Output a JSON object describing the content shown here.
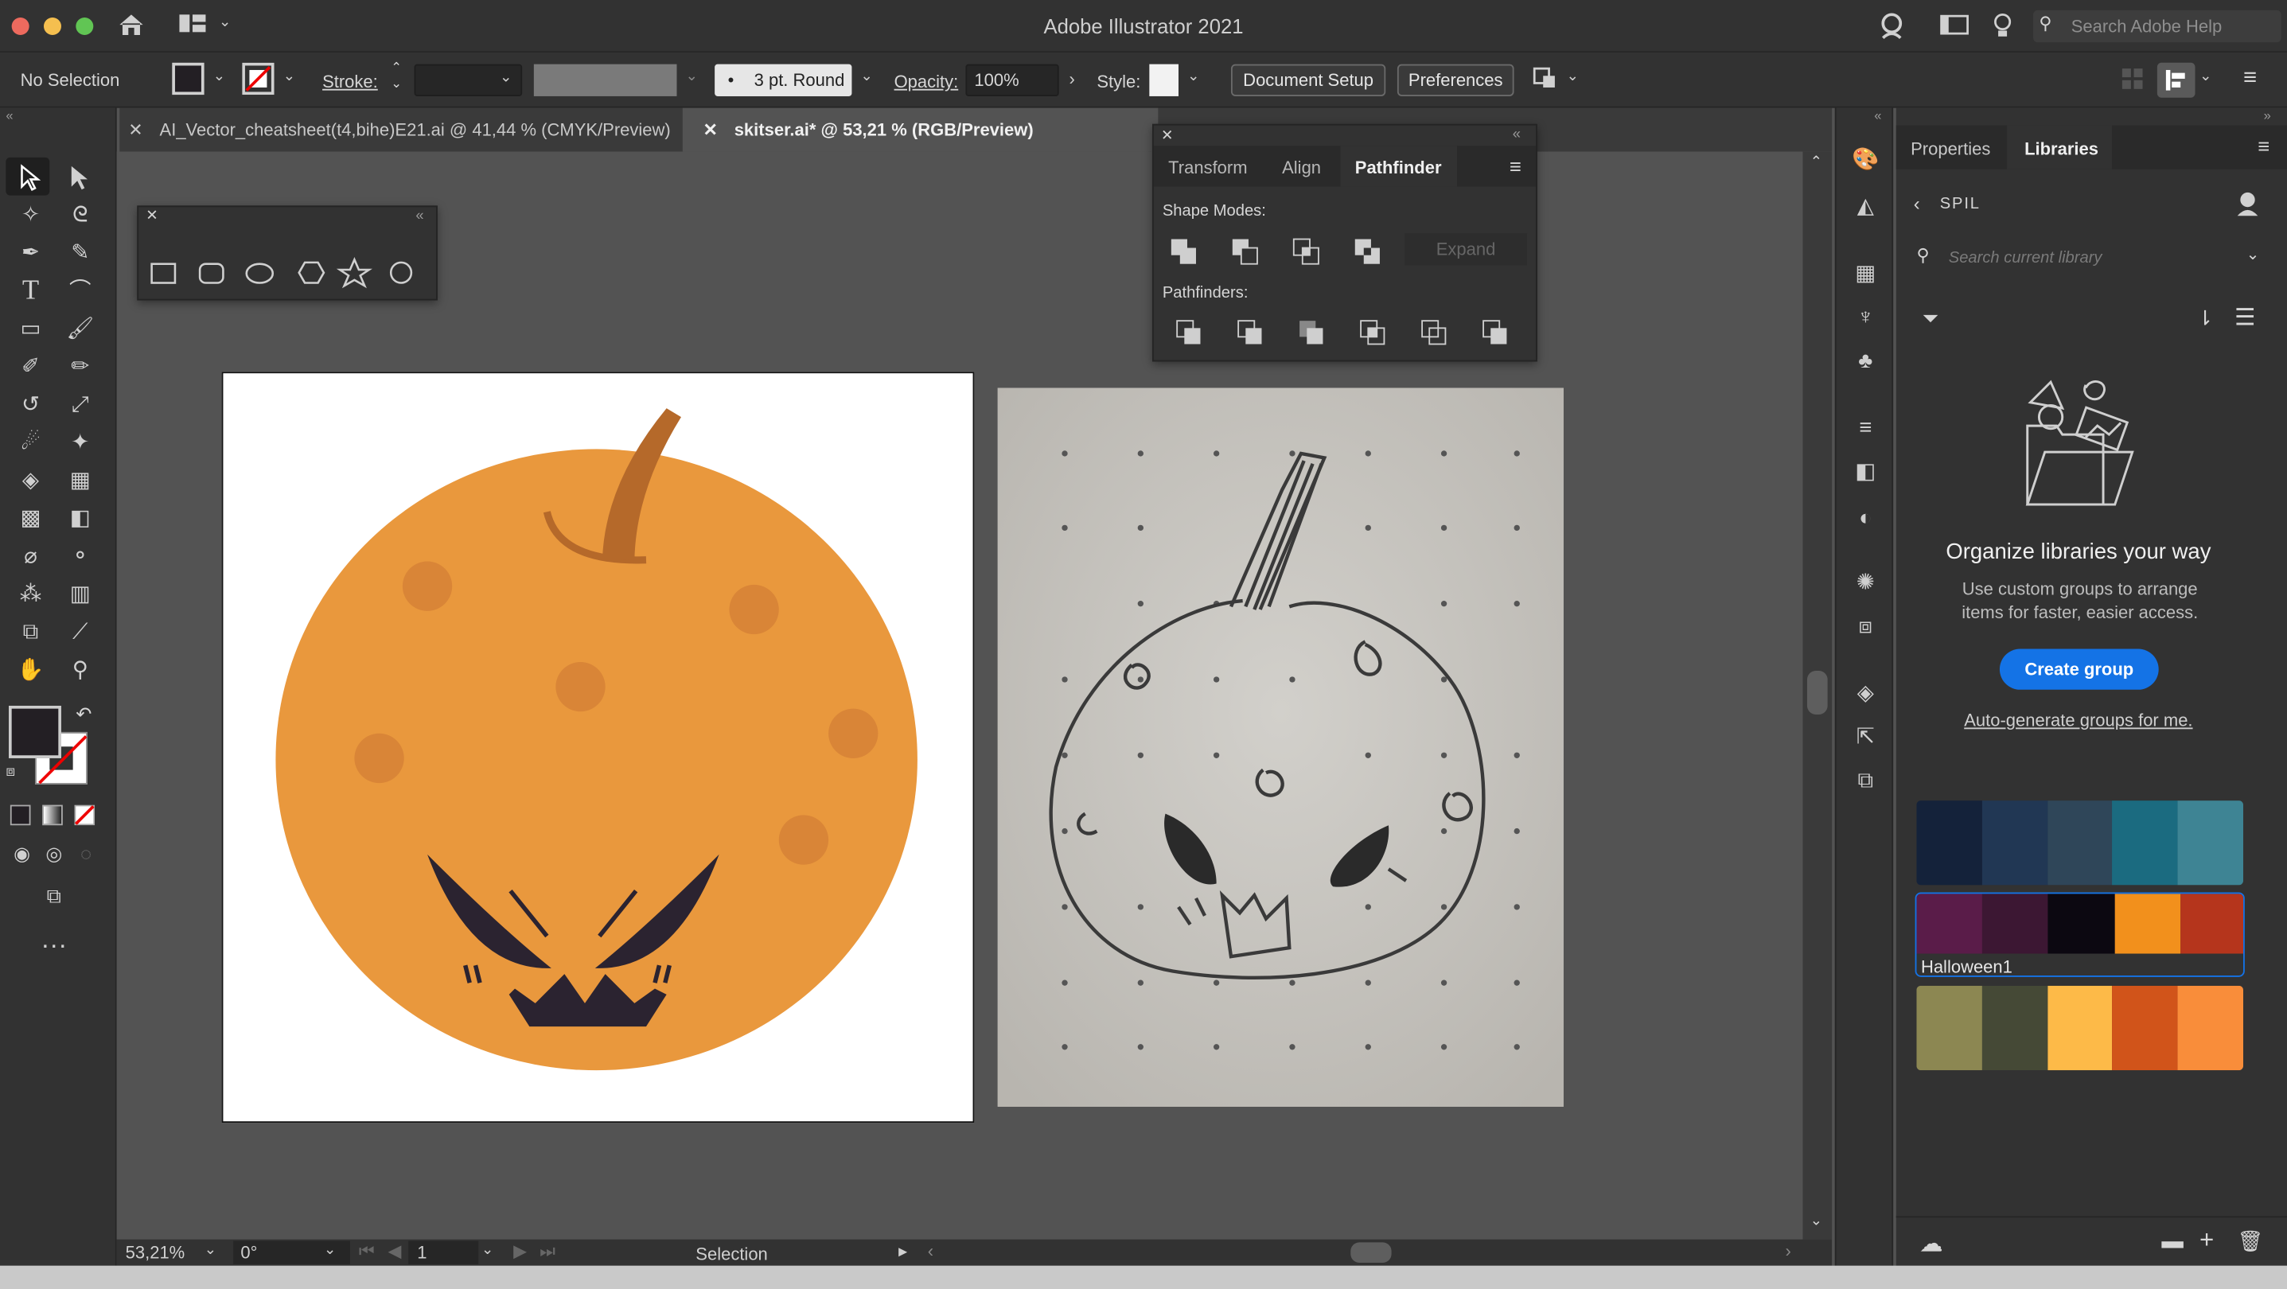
{
  "app": {
    "title": "Adobe Illustrator 2021",
    "search_placeholder": "Search Adobe Help"
  },
  "control_bar": {
    "selection_label": "No Selection",
    "stroke_label": "Stroke:",
    "brush_label": "3 pt. Round",
    "opacity_label": "Opacity:",
    "opacity_value": "100%",
    "style_label": "Style:",
    "document_setup": "Document Setup",
    "preferences": "Preferences"
  },
  "tabs": [
    {
      "label": "AI_Vector_cheatsheet(t4,bihe)E21.ai @ 41,44 % (CMYK/Preview)",
      "active": false
    },
    {
      "label": "skitser.ai* @ 53,21 % (RGB/Preview)",
      "active": true
    }
  ],
  "pathfinder_panel": {
    "tabs": [
      "Transform",
      "Align",
      "Pathfinder"
    ],
    "active_tab": "Pathfinder",
    "shape_modes_label": "Shape Modes:",
    "expand_label": "Expand",
    "pathfinders_label": "Pathfinders:"
  },
  "status_bar": {
    "zoom": "53,21%",
    "rotation": "0°",
    "artboard": "1",
    "tool": "Selection"
  },
  "right_panel": {
    "tabs": [
      "Properties",
      "Libraries"
    ],
    "active_tab": "Libraries",
    "library_name": "SPIL",
    "search_placeholder": "Search current library",
    "empty_title": "Organize libraries your way",
    "empty_text": "Use custom groups to arrange items for faster, easier access.",
    "create_group": "Create group",
    "auto_generate": "Auto-generate groups for me.",
    "swatch_groups": [
      {
        "name": "",
        "colors": [
          "#14223a",
          "#213754",
          "#2f4659",
          "#1b6b80",
          "#3e8494"
        ]
      },
      {
        "name": "Halloween1",
        "colors": [
          "#5a1c49",
          "#3c1733",
          "#0c0811",
          "#f2901c",
          "#b5351c"
        ]
      },
      {
        "name": "",
        "colors": [
          "#8c8752",
          "#454936",
          "#fdba48",
          "#d1541a",
          "#f98d3a"
        ]
      }
    ]
  },
  "artwork": {
    "pumpkin_color": "#e9983d",
    "spot_color": "#d98537",
    "stem_color": "#b5692a",
    "face_color": "#2b2330"
  },
  "colors": {
    "accent_blue": "#1473e6",
    "ui_dark": "#323232",
    "canvas": "#535353"
  }
}
